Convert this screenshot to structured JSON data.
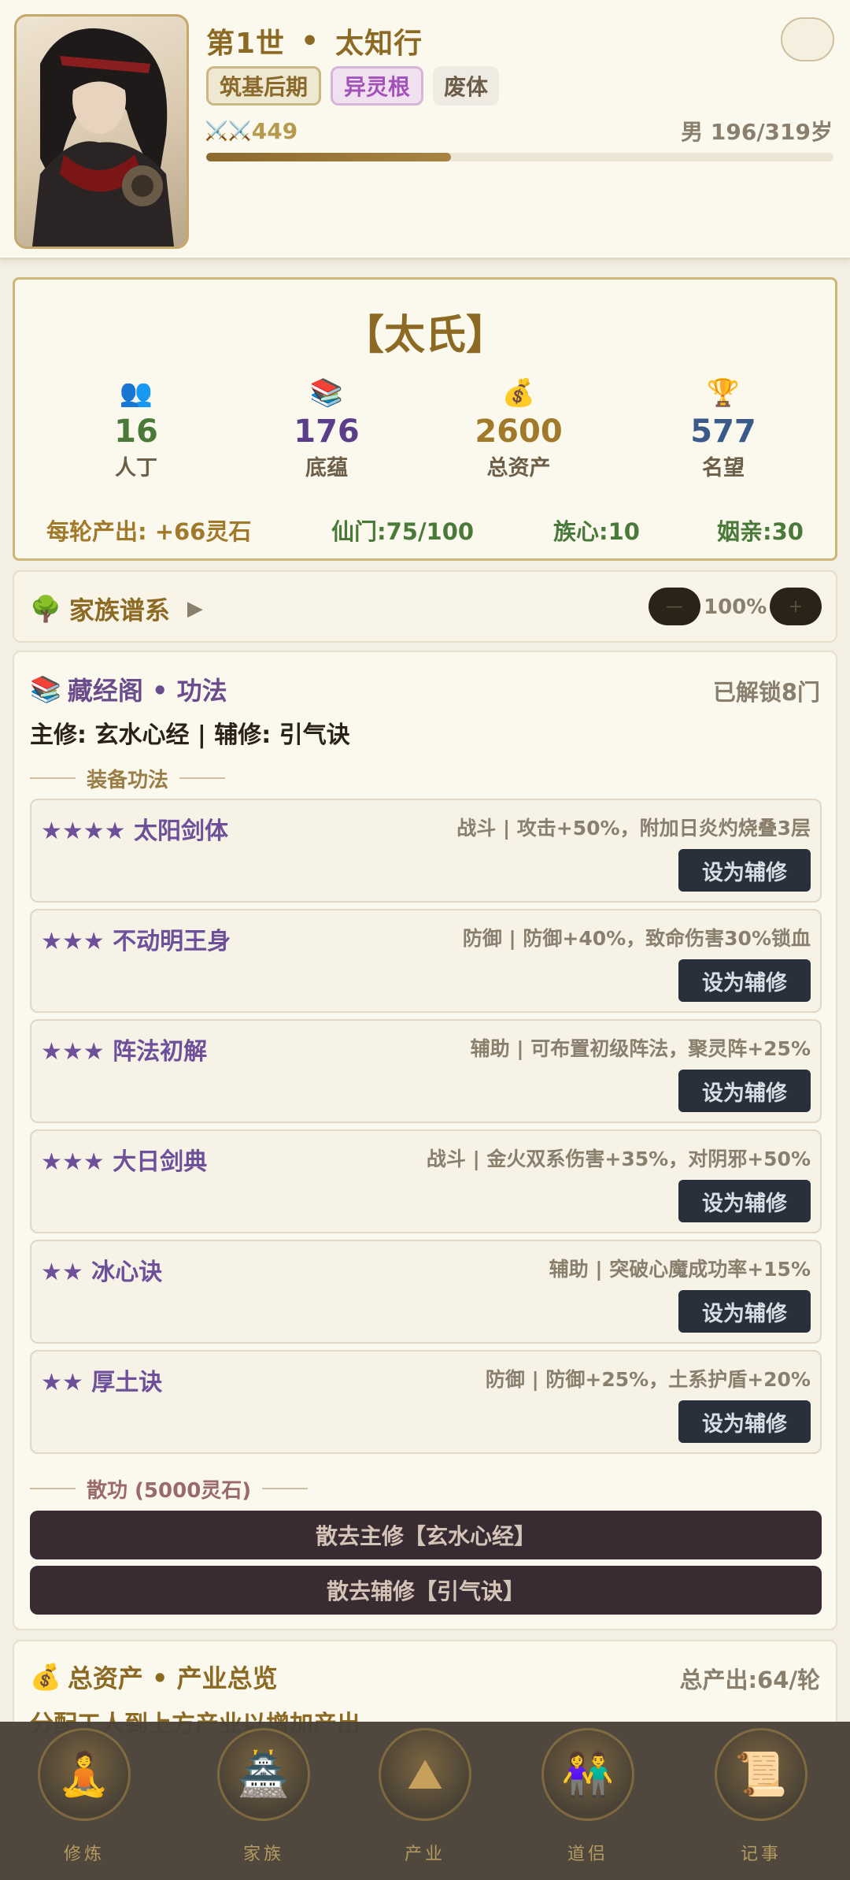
{
  "header": {
    "generation": "第1世",
    "separator": "•",
    "name": "太知行",
    "settings_icon": "",
    "tags": [
      {
        "label": "筑基后期",
        "color": "#8a6a2a"
      },
      {
        "label": "异灵根",
        "color": "#a252b8"
      },
      {
        "label": "废体",
        "color": "#6b5d4a"
      }
    ],
    "power_icon": "⚔️⚔️",
    "power": "449",
    "gender_age": "男 196/319岁",
    "lifespan_progress": 0.39
  },
  "clan": {
    "name": "【太氏】",
    "stats": [
      {
        "icon": "👥",
        "value": "16",
        "label": "人丁",
        "color": "#4a7a3a"
      },
      {
        "icon": "📚",
        "value": "176",
        "label": "底蕴",
        "color": "#5a3e8a"
      },
      {
        "icon": "💰",
        "value": "2600",
        "label": "总资产",
        "color": "#a07a2a"
      },
      {
        "icon": "🏆",
        "value": "577",
        "label": "名望",
        "color": "#3a5a8a"
      }
    ],
    "footer": [
      {
        "text": "每轮产出: +66灵石",
        "color": "#a07a2a"
      },
      {
        "text": "仙门:75/100",
        "color": "#4a7a3a"
      },
      {
        "text": "族心:10",
        "color": "#4a7a3a"
      },
      {
        "text": "姻亲:30",
        "color": "#4a7a3a"
      }
    ]
  },
  "lineage": {
    "icon": "🌳",
    "title": "家族谱系",
    "arrow": "▶",
    "zoom_out": "—",
    "zoom": "100%",
    "zoom_in": "+"
  },
  "library": {
    "icon": "📚",
    "title": "藏经阁 • 功法",
    "unlocked": "已解锁8门",
    "main_line": "主修: 玄水心经 | 辅修: 引气诀",
    "equip_header": "装备功法",
    "button_label": "设为辅修",
    "techniques": [
      {
        "stars": "★★★★",
        "name": "太阳剑体",
        "desc": "战斗 | 攻击+50%，附加日炎灼烧叠3层"
      },
      {
        "stars": "★★★",
        "name": "不动明王身",
        "desc": "防御 | 防御+40%，致命伤害30%锁血"
      },
      {
        "stars": "★★★",
        "name": "阵法初解",
        "desc": "辅助 | 可布置初级阵法，聚灵阵+25%"
      },
      {
        "stars": "★★★",
        "name": "大日剑典",
        "desc": "战斗 | 金火双系伤害+35%，对阴邪+50%"
      },
      {
        "stars": "★★",
        "name": "冰心诀",
        "desc": "辅助 | 突破心魔成功率+15%"
      },
      {
        "stars": "★★",
        "name": "厚土诀",
        "desc": "防御 | 防御+25%，土系护盾+20%"
      }
    ],
    "disperse_header": "散功 (5000灵石)",
    "disperse_main": "散去主修【玄水心经】",
    "disperse_aux": "散去辅修【引气诀】"
  },
  "assets": {
    "icon": "💰",
    "title": "总资产 • 产业总览",
    "total": "总产出:64/轮",
    "hint": "分配工人到上方产业以增加产出"
  },
  "nav": [
    {
      "icon": "🧘",
      "label": "修炼"
    },
    {
      "icon": "🏯",
      "label": "家族"
    },
    {
      "icon": "⛰",
      "label": "产业"
    },
    {
      "icon": "👫",
      "label": "道侣"
    },
    {
      "icon": "📜",
      "label": "记事"
    }
  ]
}
